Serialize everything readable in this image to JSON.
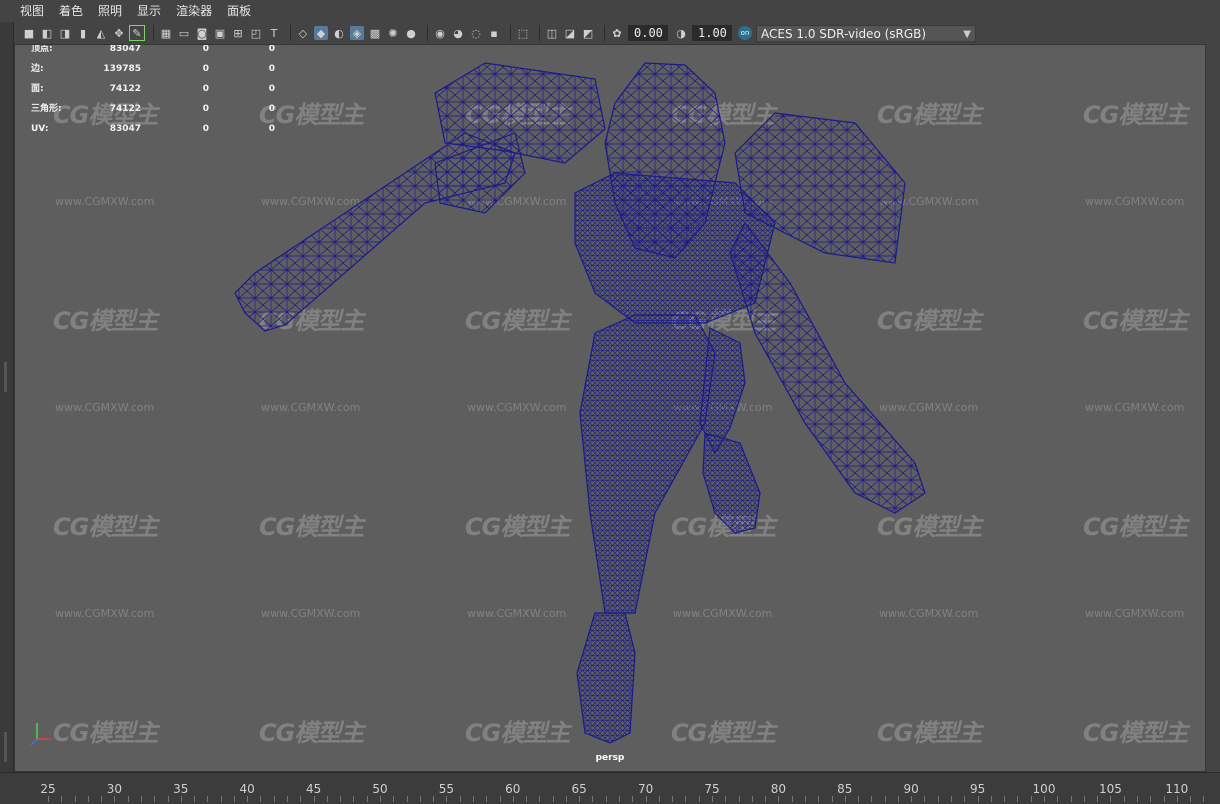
{
  "menu": [
    "视图",
    "着色",
    "照明",
    "显示",
    "渲染器",
    "面板"
  ],
  "toolbar": {
    "exposure_value": "0.00",
    "gamma_value": "1.00",
    "colorspace": "ACES 1.0 SDR-video (sRGB)",
    "icons": [
      "camera-select-icon",
      "camera-lock-icon",
      "camera-attr-icon",
      "bookmark-icon",
      "image-plane-icon",
      "2d-pan-icon",
      "grease-pencil-icon",
      "grid-icon",
      "film-gate-icon",
      "resolution-gate-icon",
      "gate-mask-icon",
      "field-chart-icon",
      "safe-action-icon",
      "safe-title-icon",
      "wireframe-icon",
      "smooth-shade-icon",
      "shade-default-icon",
      "wireframe-on-shaded-icon",
      "textured-icon",
      "lights-icon",
      "shadows-icon",
      "screen-space-ao-icon",
      "motion-blur-icon",
      "anti-alias-icon",
      "depth-of-field-icon",
      "isolate-select-icon",
      "xray-icon",
      "xray-joints-icon",
      "xray-active-icon",
      "backface-icon",
      "exposure-icon",
      "gamma-icon",
      "color-management-icon"
    ]
  },
  "hud": {
    "rows": [
      {
        "label": "顶点:",
        "v1": "83047",
        "v2": "0",
        "v3": "0"
      },
      {
        "label": "边:",
        "v1": "139785",
        "v2": "0",
        "v3": "0"
      },
      {
        "label": "面:",
        "v1": "74122",
        "v2": "0",
        "v3": "0"
      },
      {
        "label": "三角形:",
        "v1": "74122",
        "v2": "0",
        "v3": "0"
      },
      {
        "label": "UV:",
        "v1": "83047",
        "v2": "0",
        "v3": "0"
      }
    ]
  },
  "viewport": {
    "camera": "persp",
    "wire_color": "#1a1a8c",
    "bg_color": "#5e5e5e"
  },
  "watermark": {
    "logo": "CG模型主",
    "url": "www.CGMXW.com"
  },
  "timeline": {
    "labels": [
      "25",
      "30",
      "35",
      "40",
      "45",
      "50",
      "55",
      "60",
      "65",
      "70",
      "75",
      "80",
      "85",
      "90",
      "95",
      "100",
      "105",
      "110"
    ]
  },
  "colors": {
    "accent": "#5a7a9c",
    "active_green": "#7bd36a"
  }
}
